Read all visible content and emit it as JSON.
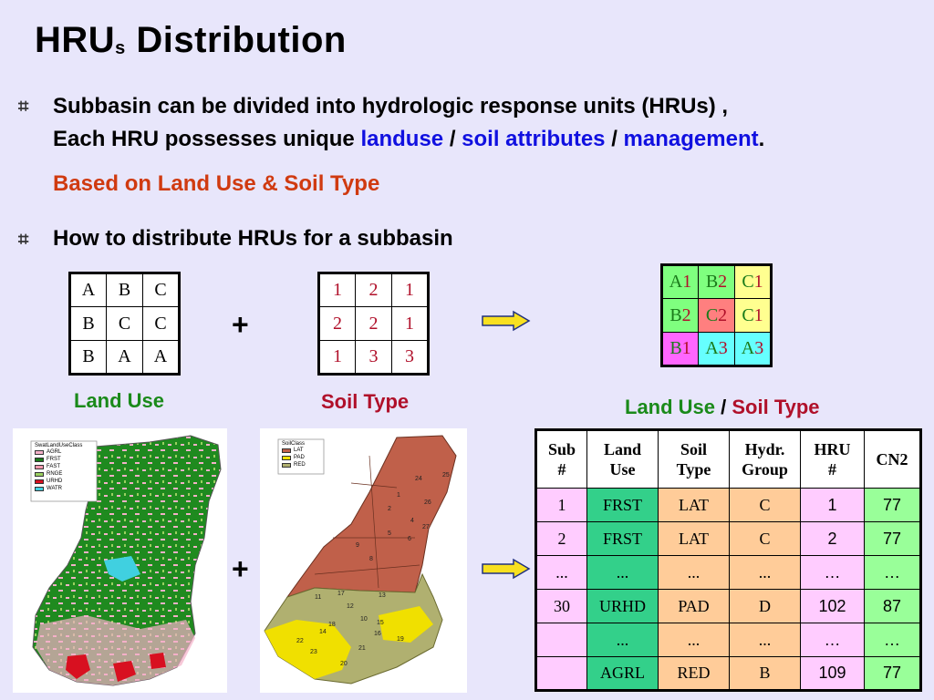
{
  "title": {
    "main": "HRU",
    "sub": "s",
    "rest": " Distribution"
  },
  "bullets": {
    "b1_line1": "Subbasin can be divided into hydrologic response units (HRUs) ,",
    "b1_line2_pre": "Each HRU possesses unique ",
    "landuse": "landuse",
    "slash": " / ",
    "soil_attributes": "soil attributes",
    "management": "management",
    "period": ".",
    "based_on": "Based on Land Use & Soil Type",
    "b2": "How to distribute HRUs for a subbasin"
  },
  "landuse_grid": [
    [
      "A",
      "B",
      "C"
    ],
    [
      "B",
      "C",
      "C"
    ],
    [
      "B",
      "A",
      "A"
    ]
  ],
  "soil_grid": [
    [
      "1",
      "2",
      "1"
    ],
    [
      "2",
      "2",
      "1"
    ],
    [
      "1",
      "3",
      "3"
    ]
  ],
  "combined_grid": [
    [
      {
        "l": "A",
        "s": "1",
        "bg": "#7fff7f"
      },
      {
        "l": "B",
        "s": "2",
        "bg": "#7fff7f"
      },
      {
        "l": "C",
        "s": "1",
        "bg": "#ffff90"
      }
    ],
    [
      {
        "l": "B",
        "s": "2",
        "bg": "#7fff7f"
      },
      {
        "l": "C",
        "s": "2",
        "bg": "#ff7f7f"
      },
      {
        "l": "C",
        "s": "1",
        "bg": "#ffff90"
      }
    ],
    [
      {
        "l": "B",
        "s": "1",
        "bg": "#ff66ff"
      },
      {
        "l": "A",
        "s": "3",
        "bg": "#66ffff"
      },
      {
        "l": "A",
        "s": "3",
        "bg": "#66ffff"
      }
    ]
  ],
  "captions": {
    "land_use": "Land Use",
    "soil_type": "Soil Type",
    "slash": " / "
  },
  "plus": "+",
  "landuse_legend": {
    "title": "SwatLandUseClass",
    "items": [
      {
        "label": "AGRL",
        "color": "#f4b0c8"
      },
      {
        "label": "FRST",
        "color": "#1a7a1a"
      },
      {
        "label": "FAST",
        "color": "#ff9ab0"
      },
      {
        "label": "RNGE",
        "color": "#9ad060"
      },
      {
        "label": "URHD",
        "color": "#d81020"
      },
      {
        "label": "WATR",
        "color": "#40d0e0"
      }
    ]
  },
  "soil_legend": {
    "title": "SoilClass",
    "items": [
      {
        "label": "LAT",
        "color": "#c0604a"
      },
      {
        "label": "PAD",
        "color": "#f0e000"
      },
      {
        "label": "RED",
        "color": "#b0b070"
      }
    ]
  },
  "soil_map_labels": [
    "24",
    "25",
    "1",
    "2",
    "26",
    "4",
    "27",
    "6",
    "5",
    "8",
    "9",
    "11",
    "17",
    "12",
    "13",
    "10",
    "14",
    "18",
    "19",
    "15",
    "22",
    "23",
    "20",
    "21",
    "16"
  ],
  "hru_table": {
    "headers": [
      [
        "Sub",
        "#"
      ],
      [
        "Land",
        "Use"
      ],
      [
        "Soil",
        "Type"
      ],
      [
        "Hydr.",
        "Group"
      ],
      [
        "HRU",
        "#"
      ],
      [
        "CN2",
        ""
      ]
    ],
    "rows": [
      [
        "1",
        "FRST",
        "LAT",
        "C",
        "1",
        "77"
      ],
      [
        "2",
        "FRST",
        "LAT",
        "C",
        "2",
        "77"
      ],
      [
        "...",
        "...",
        "...",
        "...",
        "…",
        "…"
      ],
      [
        "30",
        "URHD",
        "PAD",
        "D",
        "102",
        "87"
      ],
      [
        "",
        "...",
        "...",
        "...",
        "…",
        "…"
      ],
      [
        "",
        "AGRL",
        "RED",
        "B",
        "109",
        "77"
      ]
    ],
    "col_colors": [
      "#ffccff",
      "#33d08a",
      "#ffcc99",
      "#ffcc99",
      "#ffccff",
      "#99ff99"
    ]
  }
}
